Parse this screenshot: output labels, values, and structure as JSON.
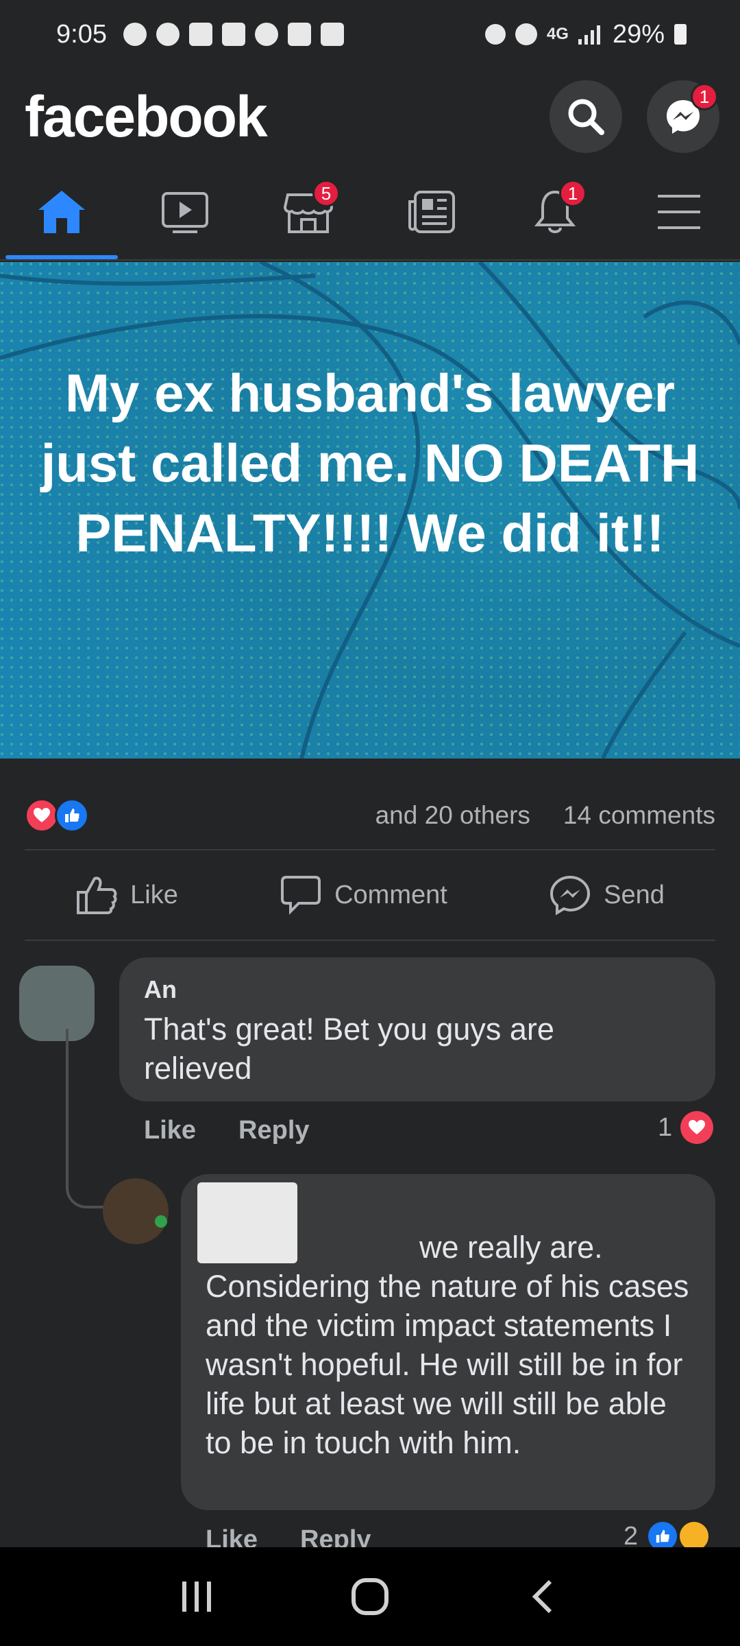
{
  "status": {
    "time": "9:05",
    "network": "4G",
    "battery": "29%",
    "notification_icons": [
      "messenger-icon",
      "facebook-icon",
      "app-grid-icon",
      "youtube-icon",
      "playstation-icon",
      "app-grid-icon",
      "gallery-icon"
    ]
  },
  "header": {
    "logo": "facebook",
    "messenger_badge": "1"
  },
  "nav": {
    "tabs": [
      {
        "name": "home",
        "badge": ""
      },
      {
        "name": "watch",
        "badge": ""
      },
      {
        "name": "marketplace",
        "badge": "5"
      },
      {
        "name": "news",
        "badge": ""
      },
      {
        "name": "notifications",
        "badge": "1"
      },
      {
        "name": "menu",
        "badge": ""
      }
    ],
    "marketplace_badge": "5",
    "notifications_badge": "1"
  },
  "post": {
    "text": "My ex husband's lawyer just called me. NO DEATH PENALTY!!!! We did it!!",
    "background_color": "#1a82ab"
  },
  "reactions": {
    "others": "and 20 others",
    "comments": "14 comments"
  },
  "actions": {
    "like": "Like",
    "comment": "Comment",
    "send": "Send"
  },
  "comments": [
    {
      "author": "An",
      "text": "That's great! Bet you guys are relieved",
      "like_label": "Like",
      "reply_label": "Reply",
      "reaction_count": "1"
    },
    {
      "author": "",
      "first_line": "we really are.",
      "text": "Considering the nature of his cases and the victim impact statements I wasn't hopeful. He will still be in for life but at least we will still be able to be in touch with him.",
      "like_label": "Like",
      "reply_label": "Reply",
      "reaction_count": "2"
    }
  ]
}
